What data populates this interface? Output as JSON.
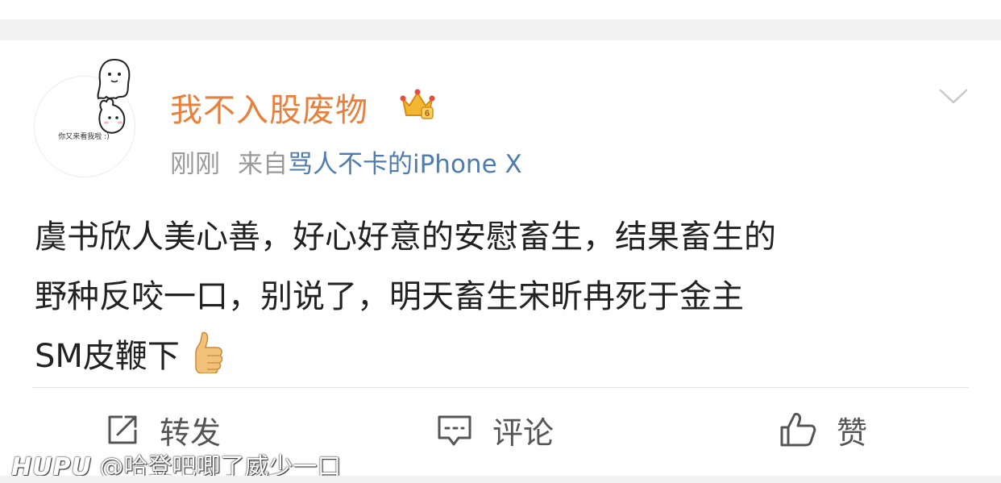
{
  "post": {
    "username": "我不入股废物",
    "avatar_caption": "你又来看我啦 :)",
    "time": "刚刚",
    "source_prefix": "来自",
    "source_name": "骂人不卡的iPhone X",
    "body_lines": [
      "虞书欣人美心善，好心好意的安慰畜生，结果畜生的",
      "野种反咬一口，别说了，明天畜生宋昕冉死于金主",
      "SM皮鞭下"
    ]
  },
  "actions": {
    "repost": "转发",
    "comment": "评论",
    "like": "赞"
  },
  "watermark": {
    "brand": "HUPU",
    "handle": "@哈登吧唧了威少一口"
  },
  "colors": {
    "username": "#e8803c",
    "source_link": "#4f7cae",
    "meta": "#9a9a9a",
    "body": "#222222",
    "action": "#555555"
  },
  "icons": {
    "badge": "crown-vip-icon",
    "menu": "chevron-down-icon",
    "emoji": "thumbs-up-emoji-icon",
    "repost": "repost-icon",
    "comment": "comment-icon",
    "like": "like-icon"
  }
}
